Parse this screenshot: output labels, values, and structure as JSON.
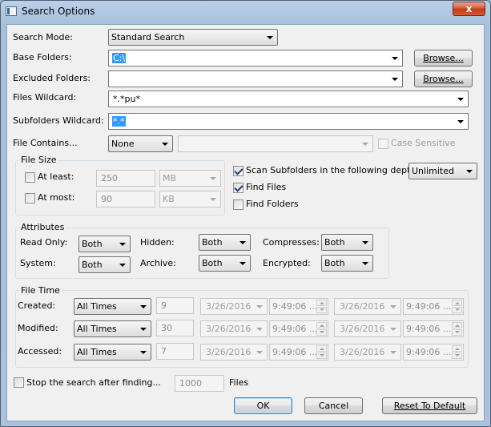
{
  "window": {
    "title": "Search Options",
    "close_glyph": "x"
  },
  "search_mode": {
    "label": "Search Mode:",
    "value": "Standard Search"
  },
  "base_folders": {
    "label": "Base Folders:",
    "value": "C:\\",
    "browse": "Browse..."
  },
  "excluded_folders": {
    "label": "Excluded Folders:",
    "value": "",
    "browse": "Browse..."
  },
  "files_wildcard": {
    "label": "Files Wildcard:",
    "value": "*.*pu*"
  },
  "subfolders_wildcard": {
    "label": "Subfolders Wildcard:",
    "value": "*.*"
  },
  "file_contains": {
    "label": "File Contains...",
    "mode": "None",
    "text": "",
    "case_sensitive": "Case Sensitive"
  },
  "file_size": {
    "title": "File Size",
    "at_least": {
      "label": "At least:",
      "value": "250",
      "unit": "MB"
    },
    "at_most": {
      "label": "At most:",
      "value": "90",
      "unit": "KB"
    }
  },
  "scan_subfolders": {
    "label": "Scan Subfolders in the following depth:",
    "depth": "Unlimited"
  },
  "find_files": {
    "label": "Find Files"
  },
  "find_folders": {
    "label": "Find Folders"
  },
  "attributes": {
    "title": "Attributes",
    "read_only": {
      "label": "Read Only:",
      "value": "Both"
    },
    "hidden": {
      "label": "Hidden:",
      "value": "Both"
    },
    "compresses": {
      "label": "Compresses:",
      "value": "Both"
    },
    "system": {
      "label": "System:",
      "value": "Both"
    },
    "archive": {
      "label": "Archive:",
      "value": "Both"
    },
    "encrypted": {
      "label": "Encrypted:",
      "value": "Both"
    }
  },
  "file_time": {
    "title": "File Time",
    "rows": [
      {
        "label": "Created:",
        "mode": "All Times",
        "num": "9",
        "date1": "3/26/2016",
        "time1": "9:49:06 ...",
        "date2": "3/26/2016",
        "time2": "9:49:06 ..."
      },
      {
        "label": "Modified:",
        "mode": "All Times",
        "num": "30",
        "date1": "3/26/2016",
        "time1": "9:49:06 ...",
        "date2": "3/26/2016",
        "time2": "9:49:06 ..."
      },
      {
        "label": "Accessed:",
        "mode": "All Times",
        "num": "7",
        "date1": "3/26/2016",
        "time1": "9:49:06 ...",
        "date2": "3/26/2016",
        "time2": "9:49:06 ..."
      }
    ]
  },
  "stop_search": {
    "label": "Stop the search after finding...",
    "value": "1000",
    "suffix": "Files"
  },
  "buttons": {
    "ok": "OK",
    "cancel": "Cancel",
    "reset": "Reset To Default"
  }
}
